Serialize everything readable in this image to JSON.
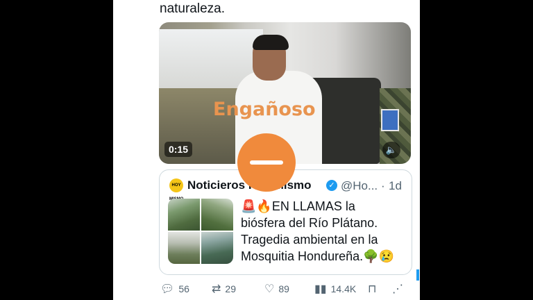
{
  "tweet": {
    "text_fragment": "naturaleza."
  },
  "video": {
    "overlay_label": "Engañoso",
    "duration": "0:15",
    "volume_icon": "speaker-icon"
  },
  "quote": {
    "avatar_text": "HOY MISMO",
    "account_name": "Noticieros Hoy Mismo",
    "verified_icon": "verified-badge-icon",
    "handle": "@Ho...",
    "separator": "·",
    "time": "1d",
    "lines": [
      "🚨🔥EN LLAMAS la",
      "biósfera del Río Plátano.",
      "Tragedia ambiental en la",
      "Mosquitia Hondureña.🌳😢"
    ]
  },
  "actions": {
    "replies": "56",
    "retweets": "29",
    "likes": "89",
    "views": "14.4K"
  },
  "colors": {
    "overlay_label": "#e8944f",
    "circle_button": "#f08a3c",
    "verified": "#1d9bf0"
  }
}
